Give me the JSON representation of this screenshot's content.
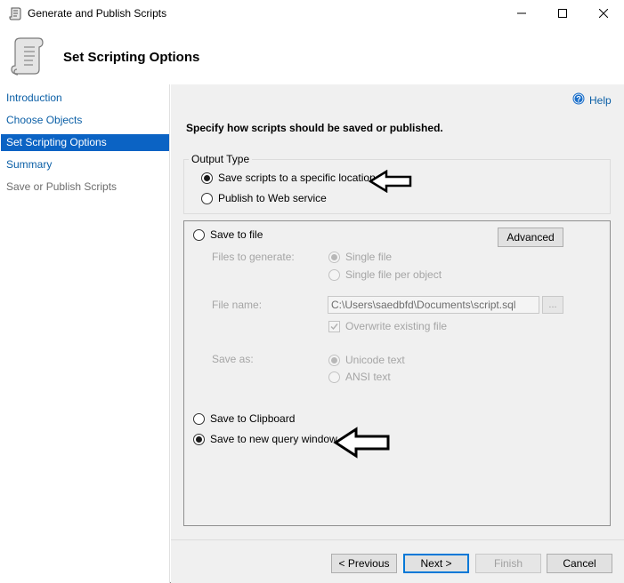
{
  "window": {
    "title": "Generate and Publish Scripts"
  },
  "header": {
    "title": "Set Scripting Options"
  },
  "nav": {
    "items": [
      {
        "label": "Introduction",
        "state": "link"
      },
      {
        "label": "Choose Objects",
        "state": "link"
      },
      {
        "label": "Set Scripting Options",
        "state": "selected"
      },
      {
        "label": "Summary",
        "state": "link"
      },
      {
        "label": "Save or Publish Scripts",
        "state": "disabled"
      }
    ]
  },
  "help": {
    "label": "Help"
  },
  "instruction": "Specify how scripts should be saved or published.",
  "output_type": {
    "legend": "Output Type",
    "options": [
      {
        "label": "Save scripts to a specific location",
        "selected": true
      },
      {
        "label": "Publish to Web service",
        "selected": false
      }
    ]
  },
  "save_options": {
    "save_to_file": {
      "label": "Save to file",
      "selected": false
    },
    "advanced_button": "Advanced",
    "files_to_generate": {
      "label": "Files to generate:",
      "options": [
        {
          "label": "Single file",
          "selected": true
        },
        {
          "label": "Single file per object",
          "selected": false
        }
      ]
    },
    "file_name": {
      "label": "File name:",
      "value": "C:\\Users\\saedbfd\\Documents\\script.sql",
      "browse_label": "..."
    },
    "overwrite": {
      "label": "Overwrite existing file",
      "checked": true
    },
    "save_as": {
      "label": "Save as:",
      "options": [
        {
          "label": "Unicode text",
          "selected": true
        },
        {
          "label": "ANSI text",
          "selected": false
        }
      ]
    },
    "save_to_clipboard": {
      "label": "Save to Clipboard",
      "selected": false
    },
    "save_to_query_window": {
      "label": "Save to new query window",
      "selected": true
    }
  },
  "footer": {
    "previous": "< Previous",
    "next": "Next >",
    "finish": "Finish",
    "cancel": "Cancel"
  },
  "colors": {
    "nav_selected": "#0b63c4",
    "link": "#0b5fa6",
    "panel_bg": "#f0f0f0"
  }
}
